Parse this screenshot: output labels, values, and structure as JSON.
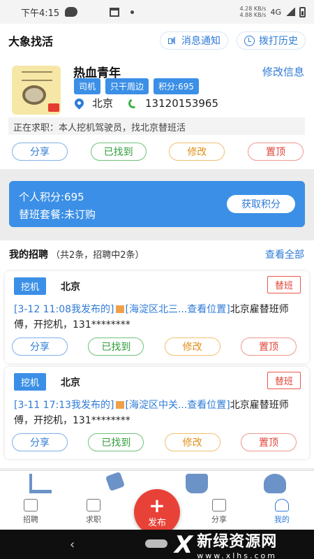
{
  "statusbar": {
    "time": "下午4:15",
    "net_up": "4.28 KB/s",
    "net_down": "4.88 KB/s",
    "network": "4G"
  },
  "header": {
    "title": "大象找活",
    "notify_label": "消息通知",
    "history_label": "拨打历史"
  },
  "profile": {
    "name": "热血青年",
    "edit_label": "修改信息",
    "tags": [
      "司机",
      "只干周边",
      "积分:695"
    ],
    "location": "北京",
    "phone": "13120153965",
    "seeking": "正在求职：本人挖机驾驶员，找北京替班活",
    "actions": {
      "share": "分享",
      "found": "已找到",
      "modify": "修改",
      "top": "置顶"
    }
  },
  "points": {
    "personal": "个人积分:695",
    "package": "替班套餐:未订购",
    "get_label": "获取积分"
  },
  "my_jobs": {
    "title": "我的招聘",
    "summary": "（共2条，招聘中2条）",
    "view_all": "查看全部",
    "items": [
      {
        "category": "挖机",
        "city": "北京",
        "type": "替班",
        "time_text": "[3-12 11:08我发布的]",
        "loc_text": "[海淀区北三...查看位置]",
        "desc": "北京雇替班师傅，开挖机，131********",
        "actions": {
          "share": "分享",
          "found": "已找到",
          "modify": "修改",
          "top": "置顶"
        }
      },
      {
        "category": "挖机",
        "city": "北京",
        "type": "替班",
        "time_text": "[3-11 17:13我发布的]",
        "loc_text": "[海淀区中关...查看位置]",
        "desc": "北京雇替班师傅，开挖机，131********",
        "actions": {
          "share": "分享",
          "found": "已找到",
          "modify": "修改",
          "top": "置顶"
        }
      }
    ]
  },
  "tabbar": {
    "recruit": "招聘",
    "job": "求职",
    "publish": "发布",
    "share": "分享",
    "mine": "我的",
    "publish_plus": "+"
  },
  "watermark": {
    "name": "新绿资源网",
    "url": "www.xlhs.com"
  },
  "colors": {
    "accent": "#3b8fe6",
    "link": "#2f7bd6",
    "publish": "#e84238"
  }
}
